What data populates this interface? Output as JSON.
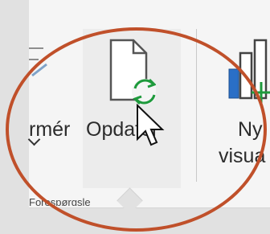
{
  "ribbon": {
    "left_cut_label": "rmér",
    "refresh_button_label": "Opdater",
    "new_visual_label_line1": "Ny",
    "new_visual_label_line2": "visua",
    "group_label": "Forespørgsle"
  },
  "icons": {
    "refresh": "document-refresh-icon",
    "new_visual": "new-visual-chart-icon",
    "left_partial": "partial-ribbon-icon",
    "cursor": "mouse-pointer-icon",
    "dropdown": "chevron-down-icon"
  },
  "colors": {
    "ribbon_bg": "#f5f5f5",
    "refresh_green": "#1e9a3c",
    "chart_blue": "#2a6fc7",
    "annotation_circle": "#c0502a"
  }
}
